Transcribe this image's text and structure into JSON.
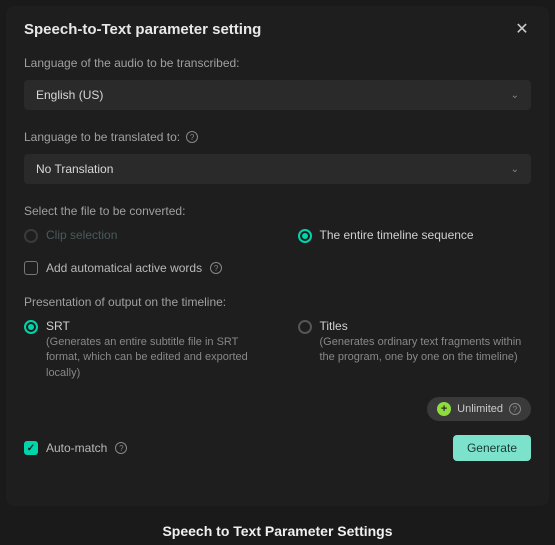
{
  "dialog": {
    "title": "Speech-to-Text parameter setting",
    "labels": {
      "audio_language": "Language of the audio to be transcribed:",
      "translate_to": "Language to be translated to:",
      "select_file": "Select the file to be converted:",
      "add_active_words": "Add automatical active words",
      "presentation": "Presentation of output on the timeline:",
      "auto_match": "Auto-match"
    },
    "selects": {
      "audio_language_value": "English (US)",
      "translate_to_value": "No Translation"
    },
    "file_options": {
      "clip_selection": "Clip selection",
      "entire_timeline": "The entire timeline sequence"
    },
    "presentation_options": {
      "srt": {
        "label": "SRT",
        "desc": "(Generates an entire subtitle file in SRT format, which can be edited and exported locally)"
      },
      "titles": {
        "label": "Titles",
        "desc": "(Generates ordinary text fragments within the program, one by one on the timeline)"
      }
    },
    "badge": {
      "unlimited": "Unlimited"
    },
    "buttons": {
      "generate": "Generate"
    }
  },
  "caption": "Speech to Text Parameter Settings"
}
